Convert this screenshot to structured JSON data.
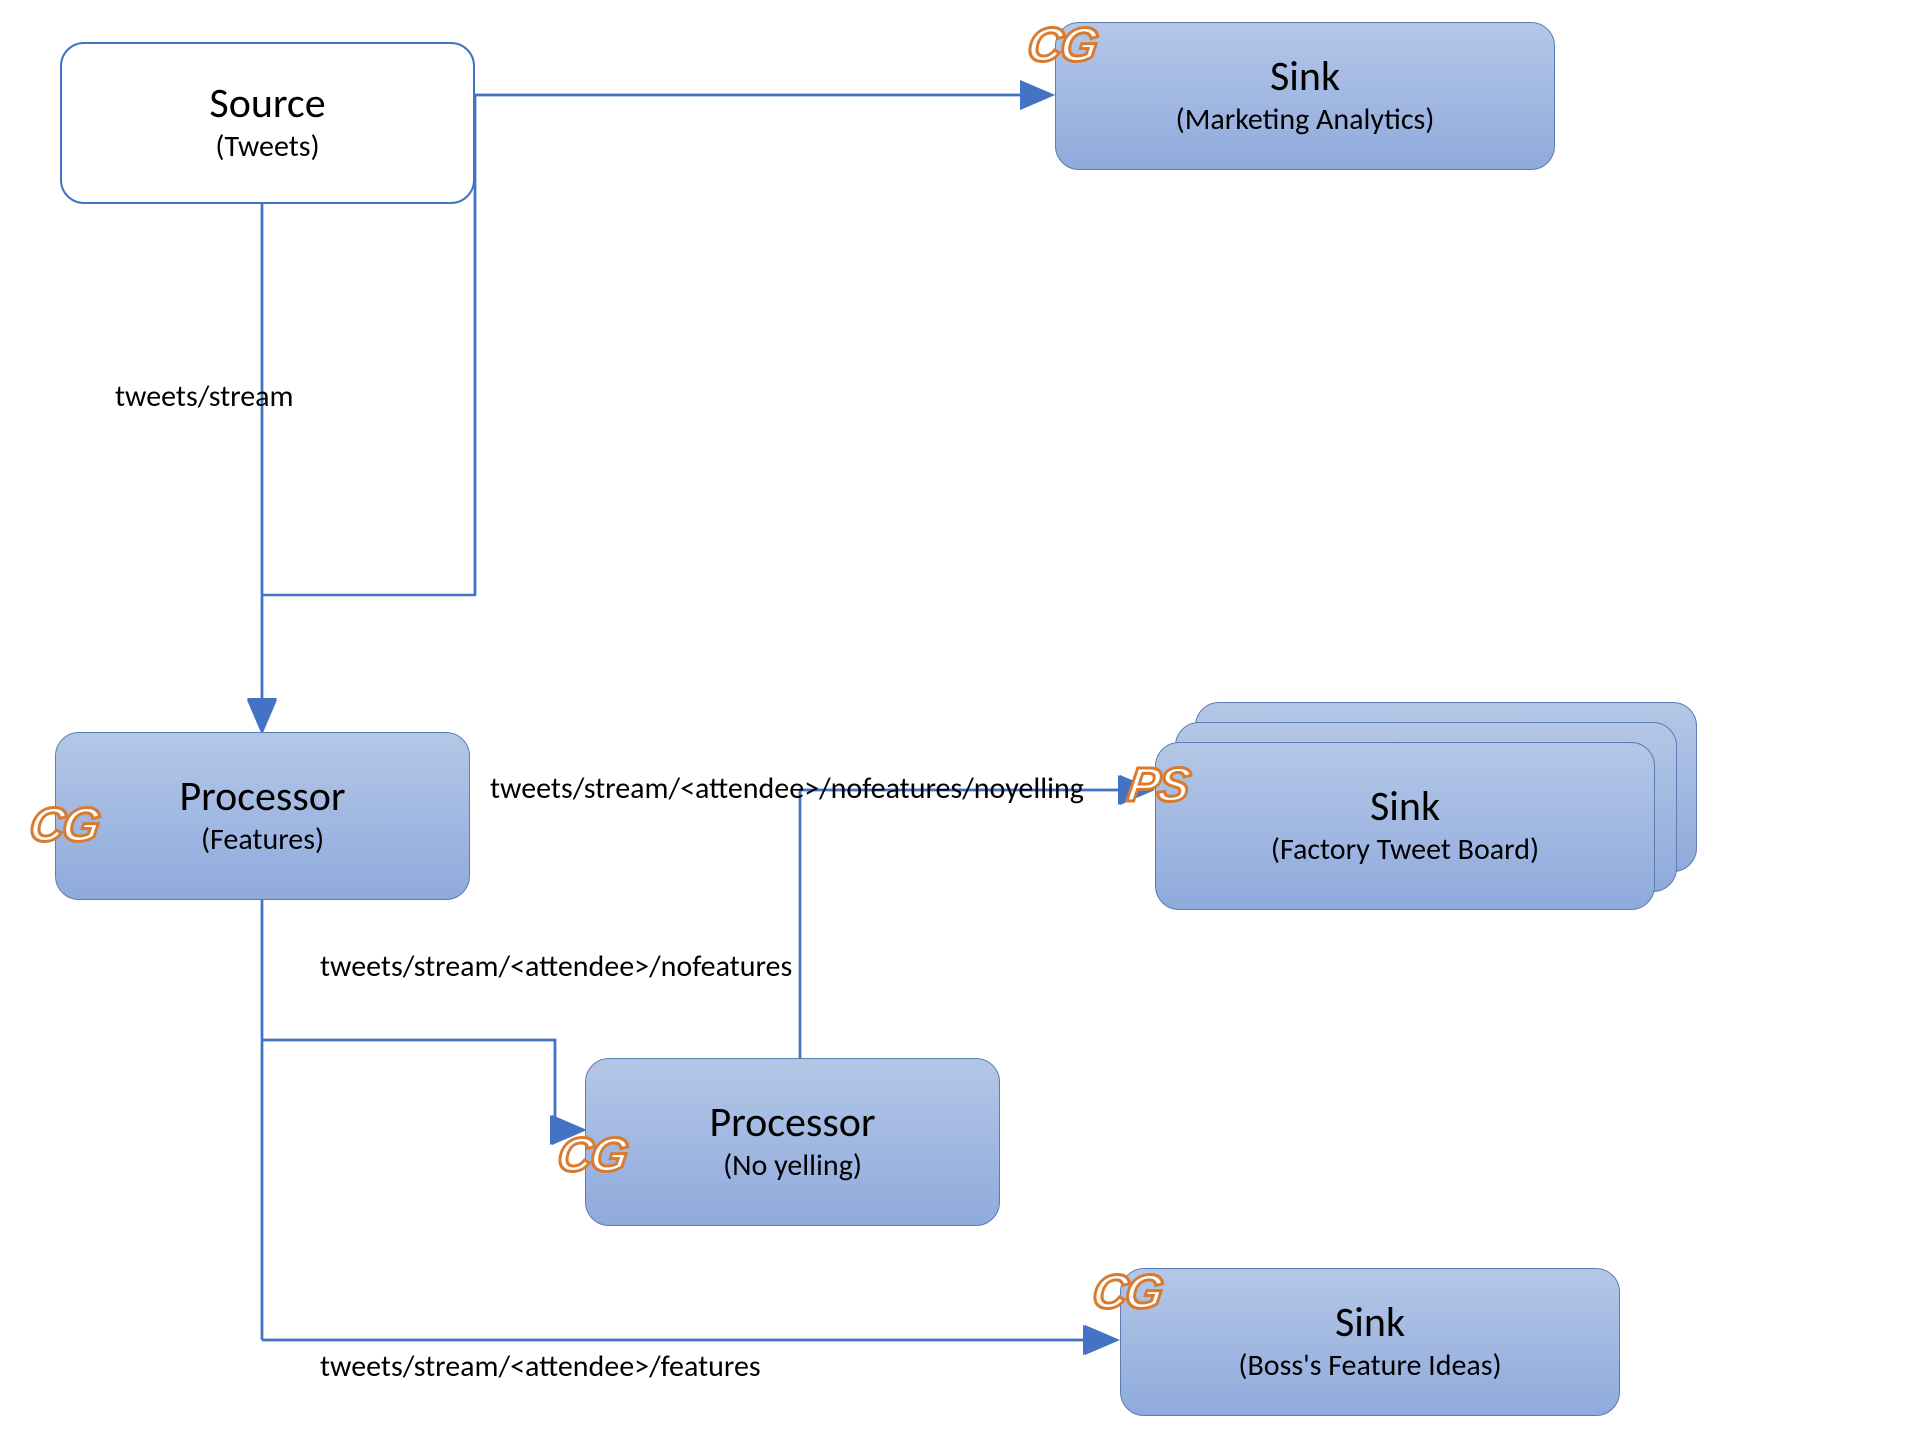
{
  "nodes": {
    "source": {
      "title": "Source",
      "subtitle": "(Tweets)"
    },
    "sink_marketing": {
      "title": "Sink",
      "subtitle": "(Marketing Analytics)"
    },
    "processor_features": {
      "title": "Processor",
      "subtitle": "(Features)"
    },
    "processor_noyelling": {
      "title": "Processor",
      "subtitle": "(No yelling)"
    },
    "sink_factory": {
      "title": "Sink",
      "subtitle": "(Factory Tweet Board)"
    },
    "sink_boss": {
      "title": "Sink",
      "subtitle": "(Boss's Feature Ideas)"
    }
  },
  "edges": {
    "e1": "tweets/stream",
    "e2": "tweets/stream/<attendee>/nofeatures/noyelling",
    "e3": "tweets/stream/<attendee>/nofeatures",
    "e4": "tweets/stream/<attendee>/features"
  },
  "badges": {
    "cg": "CG",
    "ps": "PS"
  }
}
